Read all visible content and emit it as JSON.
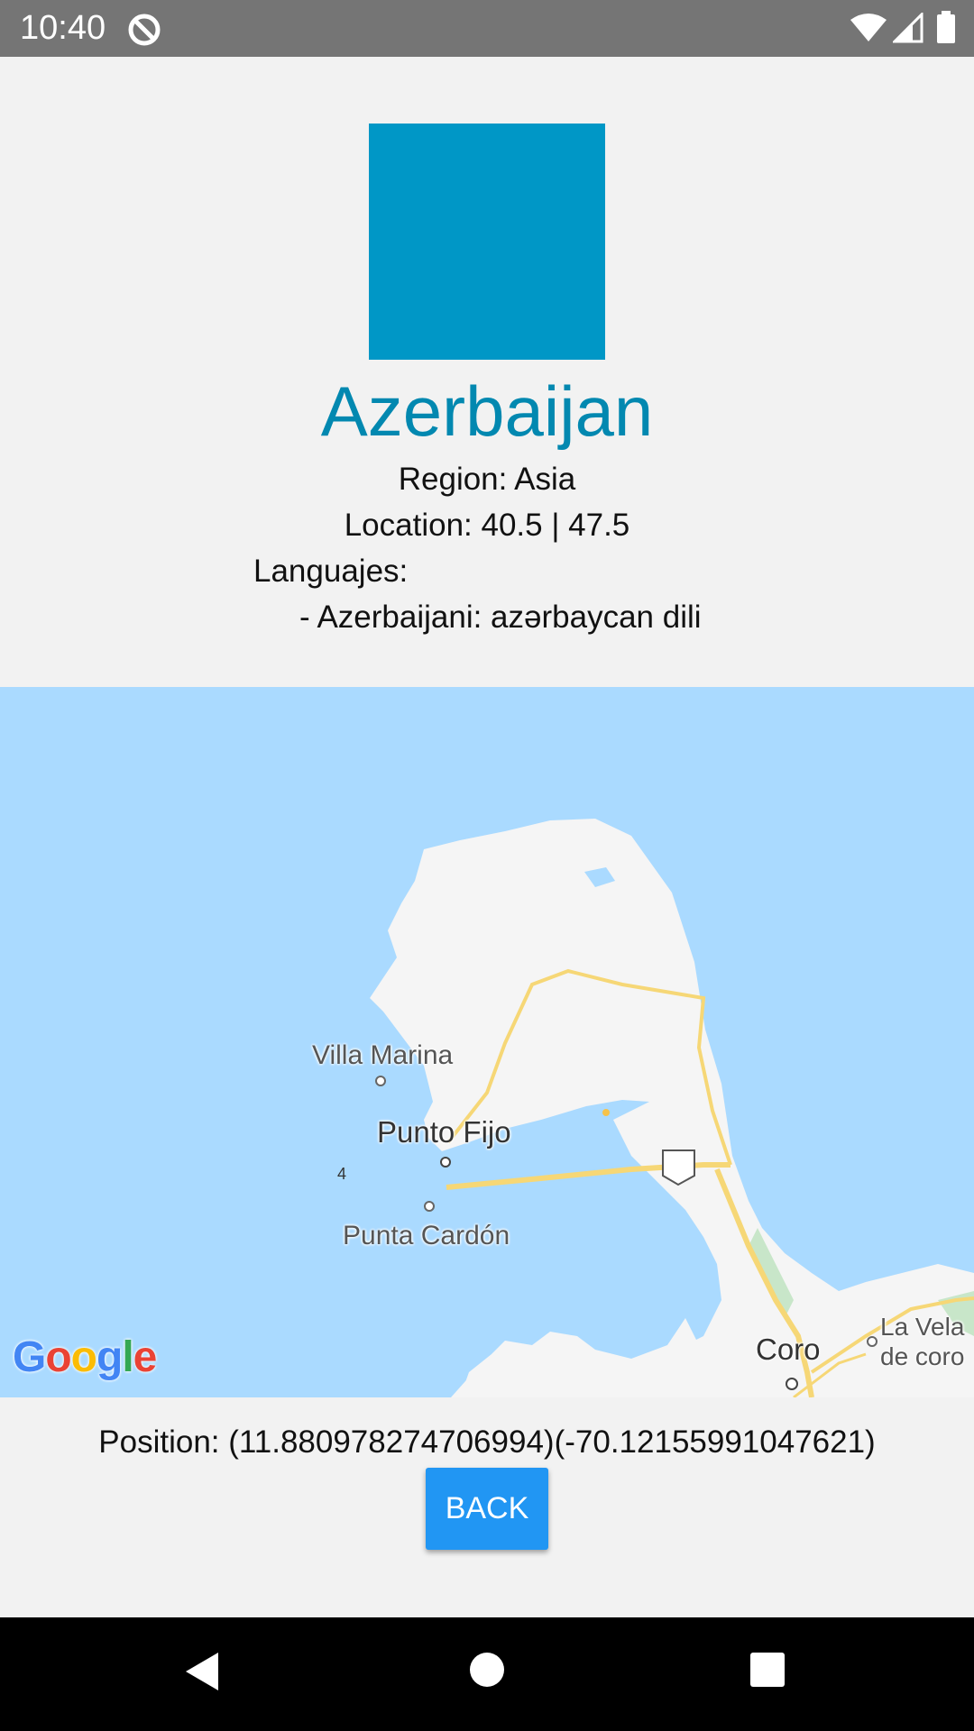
{
  "status_bar": {
    "time": "10:40",
    "icons": [
      "app-notification-icon",
      "wifi-icon",
      "signal-icon",
      "battery-icon"
    ]
  },
  "country": {
    "flag_color": "#0097c6",
    "name": "Azerbaijan",
    "region": "Region: Asia",
    "location": "Location: 40.5 | 47.5",
    "languages_label": "Languajes:",
    "languages": [
      "- Azerbaijani: azərbaycan dili"
    ]
  },
  "map": {
    "places": {
      "villa_marina": "Villa Marina",
      "punto_fijo": "Punto Fijo",
      "punta_cardon": "Punta Cardón",
      "coro": "Coro",
      "la_vela_line1": "La Vela",
      "la_vela_line2": "de coro"
    },
    "route_number": "4",
    "attribution": "Google",
    "colors": {
      "water": "#aadaff",
      "land": "#f5f5f5",
      "road": "#f6d776"
    }
  },
  "position_text": "Position: (11.880978274706994)(-70.12155991047621)",
  "back_button": {
    "label": "BACK",
    "color": "#2196f3"
  },
  "nav_bar": {
    "icons": [
      "back-triangle-icon",
      "home-circle-icon",
      "recents-square-icon"
    ]
  }
}
